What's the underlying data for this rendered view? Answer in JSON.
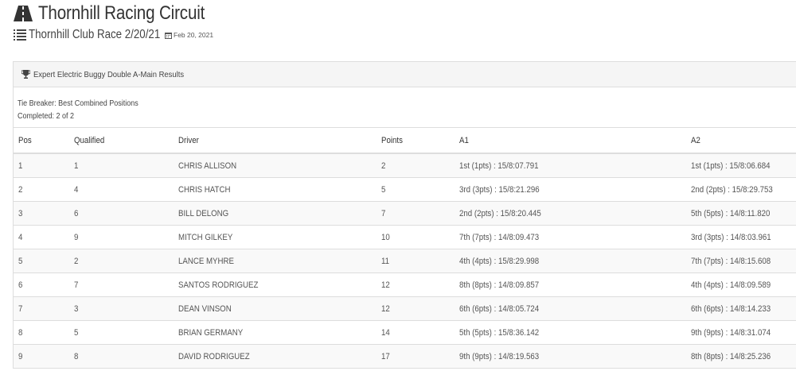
{
  "header": {
    "site_title": "Thornhill Racing Circuit",
    "event_name": "Thornhill Club Race 2/20/21",
    "event_date": "Feb 20, 2021",
    "icons": {
      "site": "road-icon",
      "event": "list-icon",
      "date": "calendar-icon"
    }
  },
  "panel": {
    "heading": "Expert Electric Buggy Double A-Main Results",
    "heading_icon": "trophy-icon",
    "tie_breaker": "Tie Breaker: Best Combined Positions",
    "completed": "Completed: 2 of 2"
  },
  "table": {
    "columns": [
      "Pos",
      "Qualified",
      "Driver",
      "Points",
      "A1",
      "A2"
    ],
    "rows": [
      {
        "pos": "1",
        "qualified": "1",
        "driver": "CHRIS ALLISON",
        "points": "2",
        "a1": "1st (1pts) : 15/8:07.791",
        "a2": "1st (1pts) : 15/8:06.684"
      },
      {
        "pos": "2",
        "qualified": "4",
        "driver": "CHRIS HATCH",
        "points": "5",
        "a1": "3rd (3pts) : 15/8:21.296",
        "a2": "2nd (2pts) : 15/8:29.753"
      },
      {
        "pos": "3",
        "qualified": "6",
        "driver": "BILL DELONG",
        "points": "7",
        "a1": "2nd (2pts) : 15/8:20.445",
        "a2": "5th (5pts) : 14/8:11.820"
      },
      {
        "pos": "4",
        "qualified": "9",
        "driver": "MITCH GILKEY",
        "points": "10",
        "a1": "7th (7pts) : 14/8:09.473",
        "a2": "3rd (3pts) : 14/8:03.961"
      },
      {
        "pos": "5",
        "qualified": "2",
        "driver": "LANCE MYHRE",
        "points": "11",
        "a1": "4th (4pts) : 15/8:29.998",
        "a2": "7th (7pts) : 14/8:15.608"
      },
      {
        "pos": "6",
        "qualified": "7",
        "driver": "SANTOS RODRIGUEZ",
        "points": "12",
        "a1": "8th (8pts) : 14/8:09.857",
        "a2": "4th (4pts) : 14/8:09.589"
      },
      {
        "pos": "7",
        "qualified": "3",
        "driver": "DEAN VINSON",
        "points": "12",
        "a1": "6th (6pts) : 14/8:05.724",
        "a2": "6th (6pts) : 14/8:14.233"
      },
      {
        "pos": "8",
        "qualified": "5",
        "driver": "BRIAN GERMANY",
        "points": "14",
        "a1": "5th (5pts) : 15/8:36.142",
        "a2": "9th (9pts) : 14/8:31.074"
      },
      {
        "pos": "9",
        "qualified": "8",
        "driver": "DAVID RODRIGUEZ",
        "points": "17",
        "a1": "9th (9pts) : 14/8:19.563",
        "a2": "8th (8pts) : 14/8:25.236"
      }
    ]
  }
}
